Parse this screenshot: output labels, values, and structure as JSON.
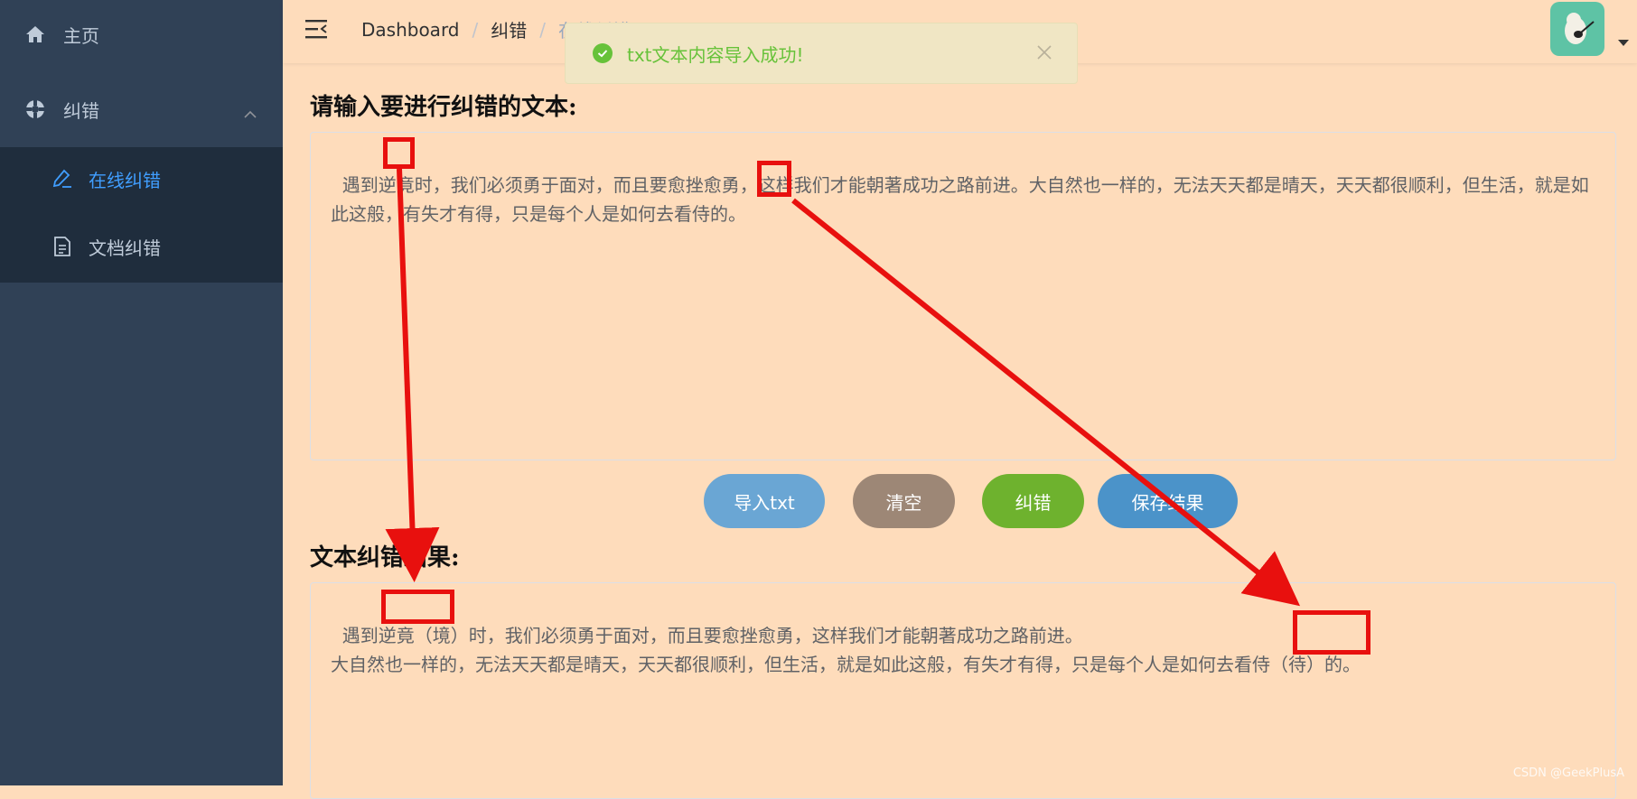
{
  "sidebar": {
    "home": "主页",
    "correction": "纠错",
    "sub_items": [
      "在线纠错",
      "文档纠错"
    ]
  },
  "breadcrumb": [
    "Dashboard",
    "纠错",
    "在线纠错"
  ],
  "toast": {
    "message": "txt文本内容导入成功!"
  },
  "input": {
    "label": "请输入要进行纠错的文本:",
    "text": "遇到逆竟时，我们必须勇于面对，而且要愈挫愈勇，这样我们才能朝著成功之路前进。大自然也一样的，无法天天都是晴天，天天都很顺利，但生活，就是如此这般，有失才有得，只是每个人是如何去看侍的。"
  },
  "buttons": {
    "import": "导入txt",
    "clear": "清空",
    "correct": "纠错",
    "save": "保存结果"
  },
  "result": {
    "label": "文本纠错结果:",
    "text": "遇到逆竟（境）时，我们必须勇于面对，而且要愈挫愈勇，这样我们才能朝著成功之路前进。\n大自然也一样的，无法天天都是晴天，天天都很顺利，但生活，就是如此这般，有失才有得，只是每个人是如何去看侍（待）的。"
  },
  "watermark": "CSDN @GeekPlusA",
  "colors": {
    "sidebar_bg": "#304156",
    "active": "#409eff",
    "success": "#67c23a",
    "annotation": "#e8100e"
  }
}
